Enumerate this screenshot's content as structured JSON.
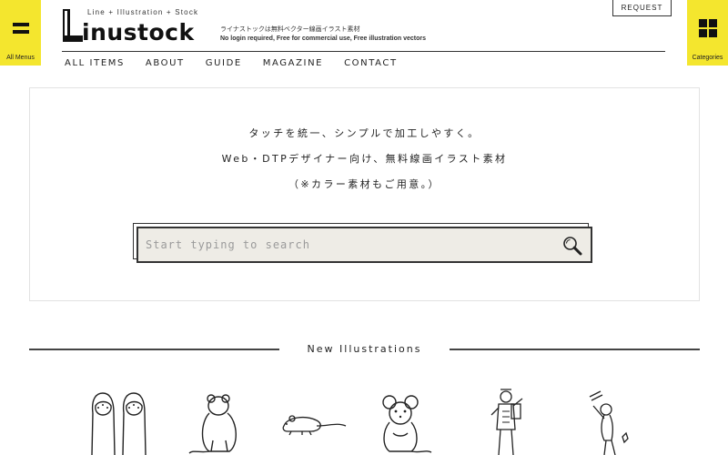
{
  "left_menu": {
    "label": "All Menus",
    "icon": "hamburger-icon"
  },
  "right_menu": {
    "label": "Categories",
    "icon": "grid-icon"
  },
  "logo": {
    "tagline": "Line + Illustration + Stock",
    "wordmark": "inustock"
  },
  "header_desc": {
    "jp": "ライナストックは無料ベクター線画イラスト素材",
    "en": "No login required, Free for commercial use, Free illustration vectors"
  },
  "request_button": "REQUEST",
  "nav": [
    {
      "label": "ALL ITEMS"
    },
    {
      "label": "ABOUT"
    },
    {
      "label": "GUIDE"
    },
    {
      "label": "MAGAZINE"
    },
    {
      "label": "CONTACT"
    }
  ],
  "hero": {
    "line1": "タッチを統一、シンプルで加工しやすく。",
    "line2": "Web・DTPデザイナー向け、無料線画イラスト素材",
    "line3": "（※カラー素材もご用意。）"
  },
  "search": {
    "placeholder": "Start typing to search",
    "icon": "search-icon"
  },
  "section": {
    "title": "New Illustrations"
  },
  "illustrations": [
    {
      "name": "sandals-illustration"
    },
    {
      "name": "rat-standing-back-illustration"
    },
    {
      "name": "mouse-running-illustration"
    },
    {
      "name": "rat-sitting-front-illustration"
    },
    {
      "name": "person-carrying-gear-illustration"
    },
    {
      "name": "person-throwing-illustration"
    }
  ]
}
